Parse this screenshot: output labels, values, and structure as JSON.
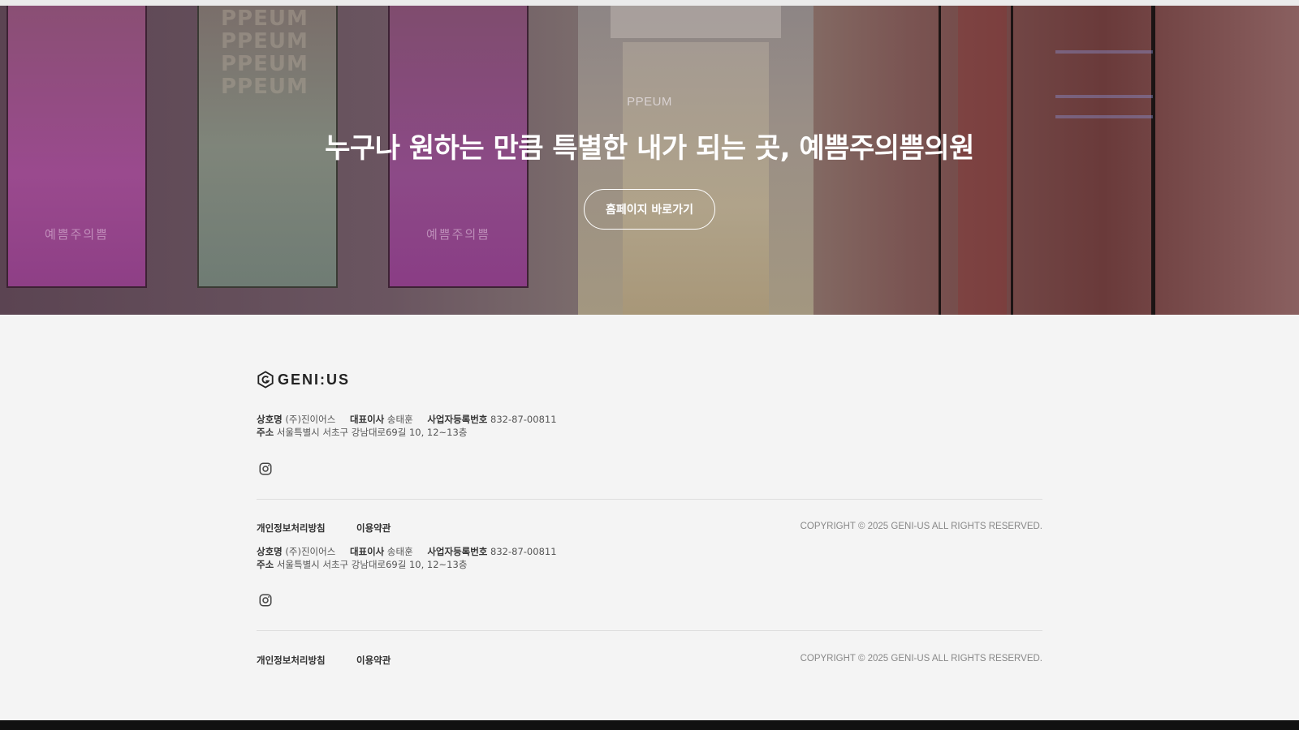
{
  "hero": {
    "eyebrow": "PPEUM",
    "title": "누구나 원하는 만큼 특별한 내가 되는 곳, 예쁨주의쁨의원",
    "button_label": "홈페이지 바로가기",
    "panel_label_1": "예쁨주의쁨",
    "panel_label_3": "예쁨주의쁨",
    "watermark": [
      "PPEUM",
      "PPEUM",
      "PPEUM",
      "PPEUM"
    ]
  },
  "footer": {
    "logo_text": "GENI:US",
    "blocks": [
      {
        "company_label": "상호명",
        "company_value": "(주)진이어스",
        "ceo_label": "대표이사",
        "ceo_value": "송태훈",
        "biz_label": "사업자등록번호",
        "biz_value": "832-87-00811",
        "address_label": "주소",
        "address_value": "서울특별시 서초구 강남대로69길 10, 12~13층",
        "privacy_link": "개인정보처리방침",
        "terms_link": "이용약관",
        "copyright": "COPYRIGHT © 2025 GENI-US ALL RIGHTS RESERVED."
      },
      {
        "company_label": "상호명",
        "company_value": "(주)진이어스",
        "ceo_label": "대표이사",
        "ceo_value": "송태훈",
        "biz_label": "사업자등록번호",
        "biz_value": "832-87-00811",
        "address_label": "주소",
        "address_value": "서울특별시 서초구 강남대로69길 10, 12~13층",
        "privacy_link": "개인정보처리방침",
        "terms_link": "이용약관",
        "copyright": "COPYRIGHT © 2025 GENI-US ALL RIGHTS RESERVED."
      }
    ],
    "icons": {
      "social": "instagram-icon",
      "logo": "hexagon-g-logo"
    }
  }
}
